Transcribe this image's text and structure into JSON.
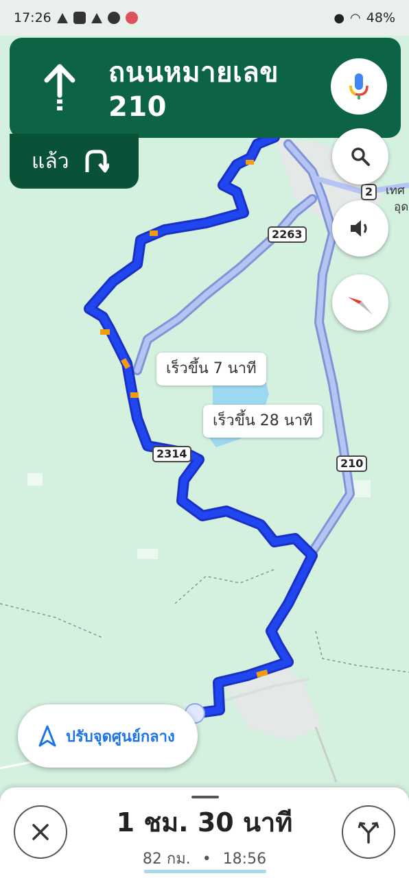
{
  "status_bar": {
    "time": "17:26",
    "battery": "48%"
  },
  "navigation": {
    "street_name": "ถนนหมายเลข 210",
    "then_label": "แล้ว"
  },
  "map": {
    "route_labels": [
      "เร็วขึ้น 7 นาที",
      "เร็วขึ้น 28 นาที"
    ],
    "road_shields": [
      "2263",
      "2314",
      "210",
      "2"
    ],
    "place_labels": [
      "เทศ",
      "อุด"
    ]
  },
  "recenter": {
    "label": "ปรับจุดศูนย์กลาง"
  },
  "trip": {
    "duration": "1 ชม. 30 นาที",
    "distance": "82 กม.",
    "separator": "•",
    "arrival": "18:56"
  },
  "colors": {
    "banner": "#0d6444",
    "route_primary": "#1a3ddb",
    "route_alt": "#9fb2f0",
    "map_bg": "#d4f0de",
    "accent": "#1a73e8"
  }
}
